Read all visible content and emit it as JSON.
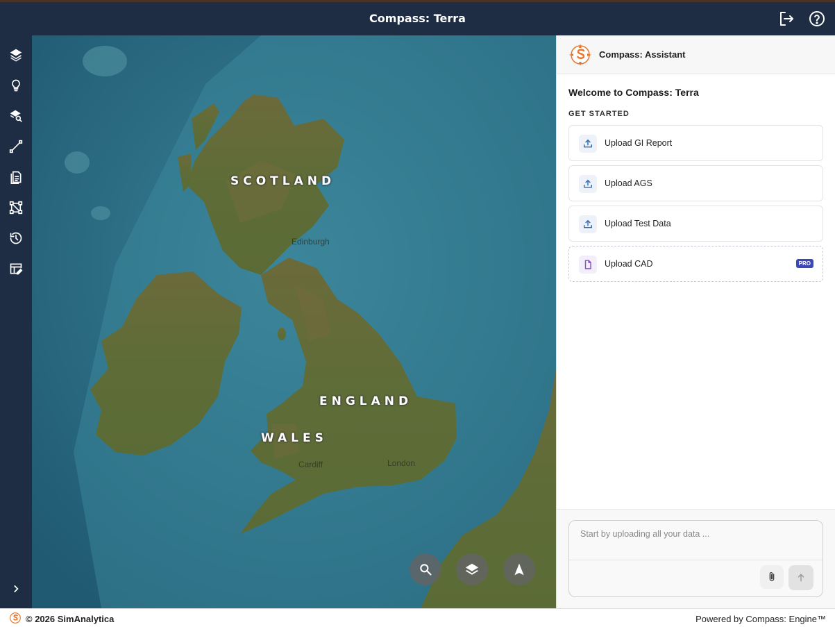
{
  "header": {
    "title": "Compass: Terra",
    "logout_icon": "logout-icon",
    "help_icon": "help-icon"
  },
  "sidebar": {
    "items": [
      {
        "name": "layers",
        "icon": "layers-icon"
      },
      {
        "name": "ideas",
        "icon": "lightbulb-icon"
      },
      {
        "name": "layer-search",
        "icon": "layer-search-icon"
      },
      {
        "name": "measure",
        "icon": "polyline-icon"
      },
      {
        "name": "documents",
        "icon": "document-icon"
      },
      {
        "name": "network",
        "icon": "network-icon"
      },
      {
        "name": "history",
        "icon": "history-icon"
      },
      {
        "name": "table-edit",
        "icon": "table-edit-icon"
      }
    ],
    "expand_icon": "chevron-right-icon"
  },
  "map": {
    "region_labels": [
      "SCOTLAND",
      "ENGLAND",
      "WALES"
    ],
    "city_labels": [
      "Edinburgh",
      "Cardiff",
      "London"
    ],
    "controls": [
      "search-icon",
      "layers-icon",
      "navigate-icon"
    ]
  },
  "assistant": {
    "title": "Compass: Assistant",
    "welcome": "Welcome to Compass: Terra",
    "section_label": "GET STARTED",
    "actions": [
      {
        "label": "Upload GI Report",
        "icon": "upload-icon"
      },
      {
        "label": "Upload AGS",
        "icon": "upload-icon"
      },
      {
        "label": "Upload Test Data",
        "icon": "upload-icon"
      },
      {
        "label": "Upload CAD",
        "icon": "file-icon",
        "badge": "PRO"
      }
    ],
    "composer": {
      "placeholder": "Start by uploading all your data ...",
      "value": ""
    }
  },
  "footer": {
    "copyright": "© 2026 SimAnalytica",
    "powered_by": "Powered by Compass: Engine™"
  },
  "colors": {
    "navy": "#1e2d44",
    "accent_orange": "#e8762c",
    "pro_badge": "#3c47b8"
  }
}
